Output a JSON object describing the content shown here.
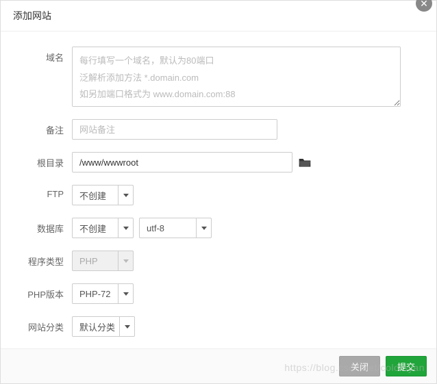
{
  "dialog": {
    "title": "添加网站"
  },
  "form": {
    "domain": {
      "label": "域名",
      "placeholder": "每行填写一个域名，默认为80端口\n泛解析添加方法 *.domain.com\n如另加端口格式为 www.domain.com:88"
    },
    "remark": {
      "label": "备注",
      "placeholder": "网站备注"
    },
    "root": {
      "label": "根目录",
      "value": "/www/wwwroot"
    },
    "ftp": {
      "label": "FTP",
      "selected": "不创建"
    },
    "database": {
      "label": "数据库",
      "selected": "不创建",
      "charset": "utf-8"
    },
    "program": {
      "label": "程序类型",
      "selected": "PHP"
    },
    "php": {
      "label": "PHP版本",
      "selected": "PHP-72"
    },
    "category": {
      "label": "网站分类",
      "selected": "默认分类"
    }
  },
  "footer": {
    "cancel": "关闭",
    "submit": "提交"
  },
  "watermark": "https://blog.csdn.net/colorsyan"
}
